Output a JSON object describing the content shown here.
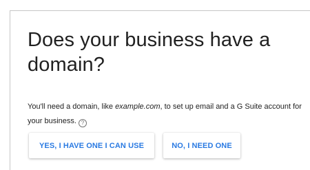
{
  "dialog": {
    "heading": "Does your business have a domain?",
    "description": {
      "part1": "You'll need a domain, like ",
      "example_domain": "example.com",
      "part2": ", to set up email and a G Suite account for your business.",
      "help_icon_glyph": "?"
    },
    "buttons": {
      "yes_label": "YES, I HAVE ONE I CAN USE",
      "no_label": "NO, I NEED ONE"
    },
    "accent_color": "#2a7ae2",
    "text_color": "#212121"
  }
}
